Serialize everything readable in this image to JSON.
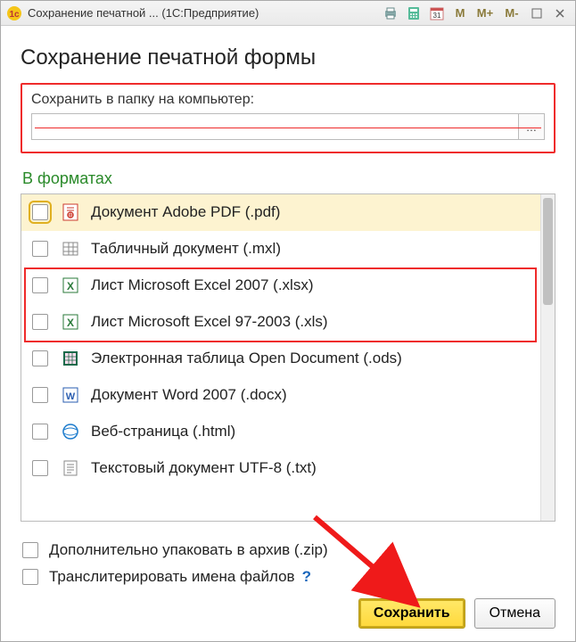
{
  "titlebar": {
    "title": "Сохранение печатной ...  (1С:Предприятие)",
    "buttons": {
      "m": "M",
      "mplus": "M+",
      "mminus": "M-"
    }
  },
  "heading": "Сохранение печатной формы",
  "folder": {
    "label": "Сохранить в папку на компьютер:",
    "value": "",
    "browse": "..."
  },
  "formats_label": "В форматах",
  "formats": [
    {
      "label": "Документ Adobe PDF (.pdf)",
      "icon": "pdf",
      "checked": false,
      "highlight": true
    },
    {
      "label": "Табличный документ (.mxl)",
      "icon": "mxl",
      "checked": false,
      "highlight": false
    },
    {
      "label": "Лист Microsoft Excel 2007 (.xlsx)",
      "icon": "xls",
      "checked": false,
      "highlight": false
    },
    {
      "label": "Лист Microsoft Excel 97-2003 (.xls)",
      "icon": "xls",
      "checked": false,
      "highlight": false
    },
    {
      "label": "Электронная таблица Open Document (.ods)",
      "icon": "ods",
      "checked": false,
      "highlight": false
    },
    {
      "label": "Документ Word 2007 (.docx)",
      "icon": "doc",
      "checked": false,
      "highlight": false
    },
    {
      "label": "Веб-страница (.html)",
      "icon": "html",
      "checked": false,
      "highlight": false
    },
    {
      "label": "Текстовый документ UTF-8 (.txt)",
      "icon": "txt",
      "checked": false,
      "highlight": false
    }
  ],
  "options": {
    "zip": "Дополнительно упаковать в архив (.zip)",
    "translit": "Транслитерировать имена файлов",
    "help": "?"
  },
  "footer": {
    "save": "Сохранить",
    "cancel": "Отмена"
  }
}
